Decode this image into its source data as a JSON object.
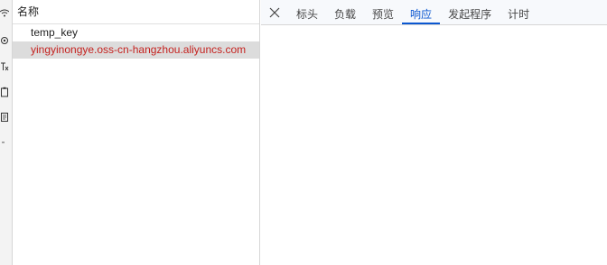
{
  "list": {
    "header": "名称",
    "rows": [
      {
        "name": "temp_key",
        "status": "normal"
      },
      {
        "name": "yingyinongye.oss-cn-hangzhou.aliyuncs.com",
        "status": "error"
      }
    ]
  },
  "detail": {
    "close_icon": "close-icon",
    "tabs": [
      {
        "label": "标头"
      },
      {
        "label": "负载"
      },
      {
        "label": "预览"
      },
      {
        "label": "响应",
        "active": true
      },
      {
        "label": "发起程序"
      },
      {
        "label": "计时"
      }
    ]
  },
  "colors": {
    "accent": "#0b57d0",
    "error_text": "#c5221f",
    "selected_row_bg": "#dcdcdc"
  },
  "strip_icons": [
    "wifi-icon",
    "settings-icon",
    "text-icon",
    "clipboard-icon",
    "note-icon",
    "dash-icon"
  ]
}
